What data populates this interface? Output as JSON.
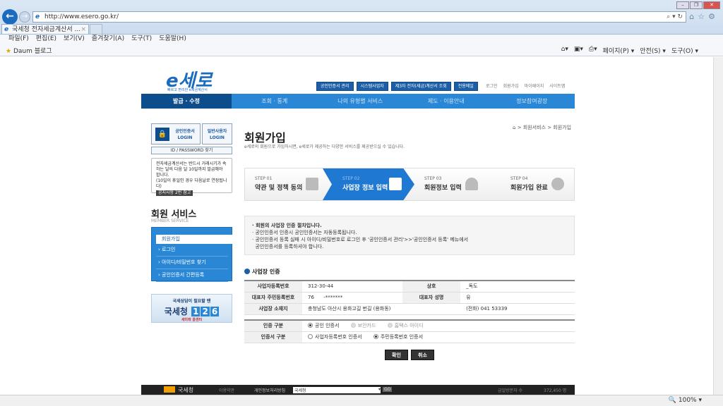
{
  "browser": {
    "url": "http://www.esero.go.kr/",
    "tab_title": "국세청 전자세금계산서 ...",
    "menu": [
      "파일(F)",
      "편집(E)",
      "보기(V)",
      "즐겨찾기(A)",
      "도구(T)",
      "도움말(H)"
    ],
    "favorite": "Daum 블로그",
    "commands": [
      "페이지(P) ▾",
      "안전(S) ▾",
      "도구(O) ▾"
    ],
    "zoom": "100%"
  },
  "site": {
    "logo": "e세로",
    "logo_sub": "빠르고 편리한 e세금계산서",
    "top_buttons": [
      "공인인증서 관리",
      "시스템사업자",
      "제3자 전자(세금)계산서 조회",
      "전용메일"
    ],
    "top_links": [
      "로그인",
      "회원가입",
      "마이페이지",
      "사이트맵"
    ],
    "gnb": [
      "발급 · 수정",
      "조회 · 통계",
      "나의 유형별 서비스",
      "제도 · 이용안내",
      "정보참여광장"
    ]
  },
  "sidebar": {
    "cert_login": "공인인증서",
    "login": "LOGIN",
    "general_login": "일반사용자",
    "idpw": "ID / PASSWORD 찾기",
    "notice": "전자세금계산서는 반드시 거래시기가 속하는 달의 다음 달 10일까지 발급해야 합니다.",
    "notice_sub": "(10일이 휴일인 경우 다음날로 연장됩니다)",
    "notice_btn": "공지사항 2번 참고",
    "service_title": "회원 서비스",
    "service_sub": "MEMBER SERVICE",
    "menu": [
      "회원가입",
      "로그인",
      "아이디/비밀번호 찾기",
      "공인인증서 간편등록"
    ],
    "banner_top": "국세상담이 필요할 땐",
    "banner_main": "국세청",
    "banner_nums": [
      "1",
      "2",
      "6"
    ],
    "banner_sub": "세미래 콜센터"
  },
  "main": {
    "breadcrumb": "> 회원서비스 > 회원가입",
    "title": "회원가입",
    "desc": "e세로의 회원으로 가입하시면, e세로가 제공하는 다양한 서비스를 제공받으실 수 있습니다.",
    "steps": [
      {
        "n": "STEP 01",
        "t": "약관 및 정책 동의"
      },
      {
        "n": "STEP 02",
        "t": "사업장 정보 입력"
      },
      {
        "n": "STEP 03",
        "t": "회원정보 입력"
      },
      {
        "n": "STEP 04",
        "t": "회원가입 완료"
      }
    ],
    "info": [
      "· 회원의 사업장 인증 절차입니다.",
      "· 공인인증서 인증시 공인인증서는 자동등록됩니다.",
      "· 공인인증서 등록 실패 시 아이디/비밀번호로 로그인 후 '공인인증서 관리'>>'공인인증서 등록' 메뉴에서",
      "  공인인증서를 등록하셔야 합니다."
    ],
    "section": "사업장 인증",
    "biz": {
      "l1": "사업자등록번호",
      "v1": "312-30-44",
      "l2": "상호",
      "v2": "_독도",
      "l3": "대표자 주민등록번호",
      "v3": "76      -*******",
      "l4": "대표자 성명",
      "v4": "유",
      "l5": "사업장 소재지",
      "v5": "충청남도 아산시 용화고길  번길  (용화동)",
      "v5b": "(전화) 041 53339"
    },
    "auth": {
      "l1": "인증 구분",
      "o1": [
        "공인 인증서",
        "보안카드",
        "홈택스 아이디"
      ],
      "l2": "인증서 구분",
      "o2": [
        "사업자등록번호 인증서",
        "주민등록번호 인증서"
      ]
    },
    "ok": "확인",
    "cancel": "취소"
  },
  "footer": {
    "brand": "국세청",
    "links": [
      "이용약관",
      "개인정보처리방침"
    ],
    "select": "국세청",
    "go": "GO",
    "visitors_label": "금일방문자 수",
    "visitors": "372,450 명"
  }
}
